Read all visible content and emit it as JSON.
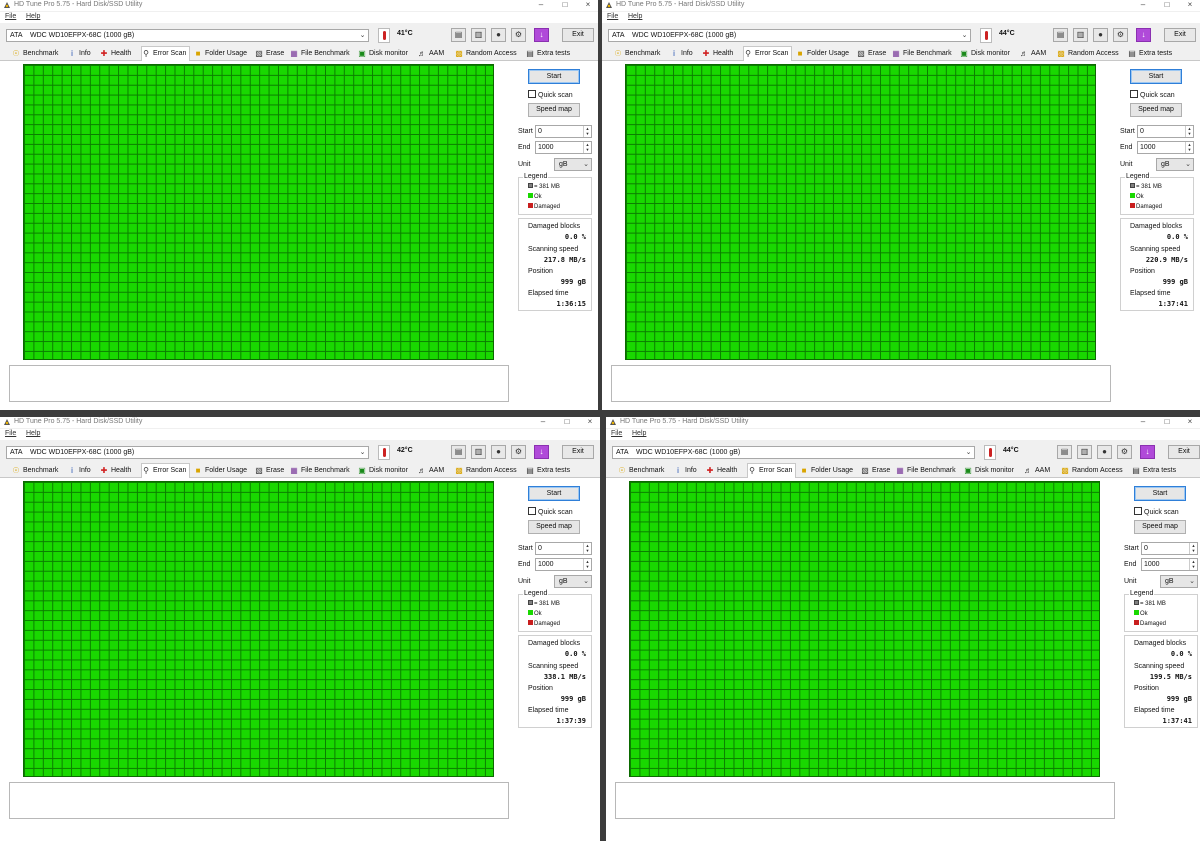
{
  "windows": [
    {
      "title": "HD Tune Pro 5.75 - Hard Disk/SSD Utility",
      "menu": [
        "File",
        "Help"
      ],
      "drive": "ATA    WDC WD10EFPX-68C (1000 gB)",
      "temperature": "41°C",
      "exit_label": "Exit",
      "tabs": [
        "Benchmark",
        "Info",
        "Health",
        "Error Scan",
        "Folder Usage",
        "Erase",
        "File Benchmark",
        "Disk monitor",
        "AAM",
        "Random Access",
        "Extra tests"
      ],
      "active_tab": "Error Scan",
      "start_label": "Start",
      "quick_scan_label": "Quick scan",
      "quick_scan_checked": false,
      "speed_map_label": "Speed map",
      "start_field_label": "Start",
      "start_value": "0",
      "end_field_label": "End",
      "end_value": "1000",
      "unit_label": "Unit",
      "unit_value": "gB",
      "legend_title": "Legend",
      "legend_block": "= 381 MB",
      "legend_ok": "Ok",
      "legend_damaged": "Damaged",
      "damaged_blocks_label": "Damaged blocks",
      "damaged_blocks_value": "0.0 %",
      "scanning_speed_label": "Scanning speed",
      "scanning_speed_value": "217.8 MB/s",
      "position_label": "Position",
      "position_value": "999 gB",
      "elapsed_label": "Elapsed time",
      "elapsed_value": "1:36:15"
    },
    {
      "title": "HD Tune Pro 5.75 - Hard Disk/SSD Utility",
      "menu": [
        "File",
        "Help"
      ],
      "drive": "ATA    WDC WD10EFPX-68C (1000 gB)",
      "temperature": "44°C",
      "exit_label": "Exit",
      "tabs": [
        "Benchmark",
        "Info",
        "Health",
        "Error Scan",
        "Folder Usage",
        "Erase",
        "File Benchmark",
        "Disk monitor",
        "AAM",
        "Random Access",
        "Extra tests"
      ],
      "active_tab": "Error Scan",
      "start_label": "Start",
      "quick_scan_label": "Quick scan",
      "quick_scan_checked": false,
      "speed_map_label": "Speed map",
      "start_field_label": "Start",
      "start_value": "0",
      "end_field_label": "End",
      "end_value": "1000",
      "unit_label": "Unit",
      "unit_value": "gB",
      "legend_title": "Legend",
      "legend_block": "= 381 MB",
      "legend_ok": "Ok",
      "legend_damaged": "Damaged",
      "damaged_blocks_label": "Damaged blocks",
      "damaged_blocks_value": "0.0 %",
      "scanning_speed_label": "Scanning speed",
      "scanning_speed_value": "220.9 MB/s",
      "position_label": "Position",
      "position_value": "999 gB",
      "elapsed_label": "Elapsed time",
      "elapsed_value": "1:37:41"
    },
    {
      "title": "HD Tune Pro 5.75 - Hard Disk/SSD Utility",
      "menu": [
        "File",
        "Help"
      ],
      "drive": "ATA    WDC WD10EFPX-68C (1000 gB)",
      "temperature": "42°C",
      "exit_label": "Exit",
      "tabs": [
        "Benchmark",
        "Info",
        "Health",
        "Error Scan",
        "Folder Usage",
        "Erase",
        "File Benchmark",
        "Disk monitor",
        "AAM",
        "Random Access",
        "Extra tests"
      ],
      "active_tab": "Error Scan",
      "start_label": "Start",
      "quick_scan_label": "Quick scan",
      "quick_scan_checked": false,
      "speed_map_label": "Speed map",
      "start_field_label": "Start",
      "start_value": "0",
      "end_field_label": "End",
      "end_value": "1000",
      "unit_label": "Unit",
      "unit_value": "gB",
      "legend_title": "Legend",
      "legend_block": "= 381 MB",
      "legend_ok": "Ok",
      "legend_damaged": "Damaged",
      "damaged_blocks_label": "Damaged blocks",
      "damaged_blocks_value": "0.0 %",
      "scanning_speed_label": "Scanning speed",
      "scanning_speed_value": "338.1 MB/s",
      "position_label": "Position",
      "position_value": "999 gB",
      "elapsed_label": "Elapsed time",
      "elapsed_value": "1:37:39"
    },
    {
      "title": "HD Tune Pro 5.75 - Hard Disk/SSD Utility",
      "menu": [
        "File",
        "Help"
      ],
      "drive": "ATA    WDC WD10EFPX-68C (1000 gB)",
      "temperature": "44°C",
      "exit_label": "Exit",
      "tabs": [
        "Benchmark",
        "Info",
        "Health",
        "Error Scan",
        "Folder Usage",
        "Erase",
        "File Benchmark",
        "Disk monitor",
        "AAM",
        "Random Access",
        "Extra tests"
      ],
      "active_tab": "Error Scan",
      "start_label": "Start",
      "quick_scan_label": "Quick scan",
      "quick_scan_checked": false,
      "speed_map_label": "Speed map",
      "start_field_label": "Start",
      "start_value": "0",
      "end_field_label": "End",
      "end_value": "1000",
      "unit_label": "Unit",
      "unit_value": "gB",
      "legend_title": "Legend",
      "legend_block": "= 381 MB",
      "legend_ok": "Ok",
      "legend_damaged": "Damaged",
      "damaged_blocks_label": "Damaged blocks",
      "damaged_blocks_value": "0.0 %",
      "scanning_speed_label": "Scanning speed",
      "scanning_speed_value": "199.5 MB/s",
      "position_label": "Position",
      "position_value": "999 gB",
      "elapsed_label": "Elapsed time",
      "elapsed_value": "1:37:41"
    }
  ],
  "colors": {
    "scan_ok": "#19d800",
    "grid_line": "#0b7e00",
    "damaged": "#c81e1e",
    "block": "#808080",
    "accent": "#2f7fd8"
  }
}
